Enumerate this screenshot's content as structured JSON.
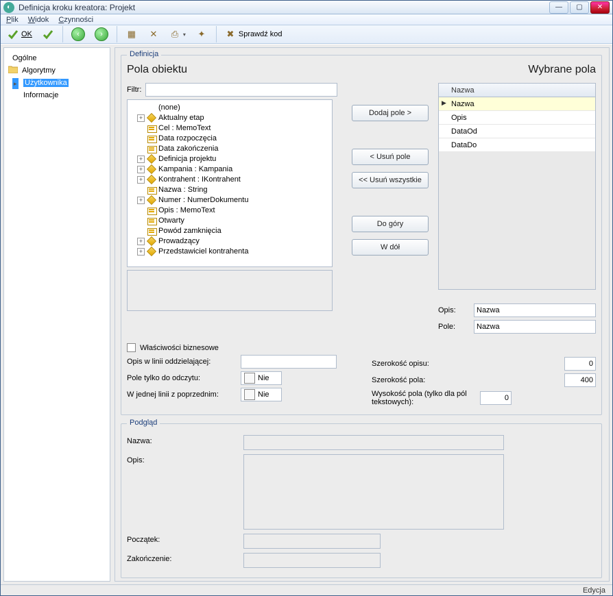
{
  "titlebar": {
    "title": "Definicja kroku kreatora: Projekt"
  },
  "menu": {
    "file": "Plik",
    "view": "Widok",
    "actions": "Czynności"
  },
  "toolbar": {
    "ok": "OK",
    "check_code": "Sprawdź kod"
  },
  "sidebar": {
    "items": [
      {
        "label": "Ogólne"
      },
      {
        "label": "Algorytmy"
      },
      {
        "label": "Użytkownika"
      },
      {
        "label": "Informacje"
      }
    ]
  },
  "definicja": {
    "legend": "Definicja",
    "pola_title": "Pola obiektu",
    "wybrane_title": "Wybrane pola",
    "filtr_label": "Filtr:",
    "filtr_value": "",
    "tree": [
      {
        "label": "(none)",
        "expandable": false,
        "icon": "none"
      },
      {
        "label": "Aktualny etap",
        "expandable": true,
        "icon": "diamond"
      },
      {
        "label": "Cel : MemoText",
        "expandable": false,
        "icon": "card"
      },
      {
        "label": "Data rozpoczęcia",
        "expandable": false,
        "icon": "card"
      },
      {
        "label": "Data zakończenia",
        "expandable": false,
        "icon": "card"
      },
      {
        "label": "Definicja projektu",
        "expandable": true,
        "icon": "diamond"
      },
      {
        "label": "Kampania : Kampania",
        "expandable": true,
        "icon": "diamond"
      },
      {
        "label": "Kontrahent : IKontrahent",
        "expandable": true,
        "icon": "diamond"
      },
      {
        "label": "Nazwa : String",
        "expandable": false,
        "icon": "card"
      },
      {
        "label": "Numer : NumerDokumentu",
        "expandable": true,
        "icon": "diamond"
      },
      {
        "label": "Opis : MemoText",
        "expandable": false,
        "icon": "card"
      },
      {
        "label": "Otwarty",
        "expandable": false,
        "icon": "card"
      },
      {
        "label": "Powód zamknięcia",
        "expandable": false,
        "icon": "card"
      },
      {
        "label": "Prowadzący",
        "expandable": true,
        "icon": "diamond"
      },
      {
        "label": "Przedstawiciel kontrahenta",
        "expandable": true,
        "icon": "diamond"
      }
    ],
    "buttons": {
      "add": "Dodaj pole >",
      "remove": "< Usuń pole",
      "remove_all": "<< Usuń wszystkie",
      "up": "Do góry",
      "down": "W dół"
    },
    "selected": {
      "header": "Nazwa",
      "rows": [
        {
          "label": "Nazwa",
          "active": true
        },
        {
          "label": "Opis"
        },
        {
          "label": "DataOd"
        },
        {
          "label": "DataDo"
        }
      ]
    },
    "opis_label": "Opis:",
    "opis_value": "Nazwa",
    "pole_label": "Pole:",
    "pole_value": "Nazwa",
    "biz_props_label": "Właściwości biznesowe",
    "sep_desc_label": "Opis w linii oddzielającej:",
    "sep_desc_value": "",
    "readonly_label": "Pole tylko do odczytu:",
    "readonly_value": "Nie",
    "same_line_label": "W jednej linii z poprzednim:",
    "same_line_value": "Nie",
    "width_desc_label": "Szerokość opisu:",
    "width_desc_value": "0",
    "width_field_label": "Szerokość pola:",
    "width_field_value": "400",
    "height_field_label": "Wysokość pola (tylko dla pól tekstowych):",
    "height_field_value": "0"
  },
  "podglad": {
    "legend": "Podgląd",
    "rows": {
      "nazwa": "Nazwa:",
      "opis": "Opis:",
      "poczatek": "Początek:",
      "zakonczenie": "Zakończenie:"
    }
  },
  "status": {
    "mode": "Edycja"
  }
}
